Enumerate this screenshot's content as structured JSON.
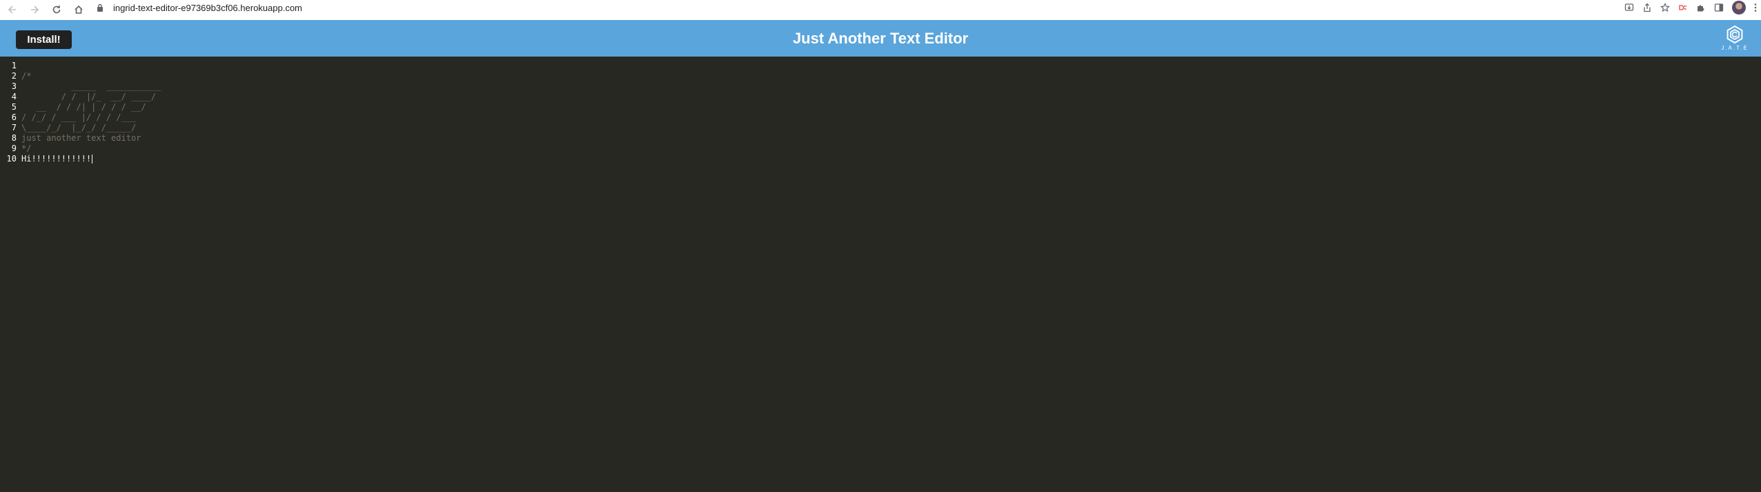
{
  "browser": {
    "url": "ingrid-text-editor-e97369b3cf06.herokuapp.com"
  },
  "header": {
    "install_label": "Install!",
    "title": "Just Another Text Editor",
    "logo_text": "J.A.T.E",
    "background": "#5aa5db"
  },
  "editor": {
    "theme_background": "#272822",
    "lines": [
      {
        "number": "1",
        "text": "",
        "style": "plain"
      },
      {
        "number": "2",
        "text": "/*",
        "style": "comment"
      },
      {
        "number": "3",
        "text": "          _____  ___________",
        "style": "comment"
      },
      {
        "number": "4",
        "text": "        / /  |/_  __/ ____/",
        "style": "comment"
      },
      {
        "number": "5",
        "text": "   __  / / /| | / / / __/",
        "style": "comment"
      },
      {
        "number": "6",
        "text": "/ /_/ / ___ |/ / / /___",
        "style": "comment"
      },
      {
        "number": "7",
        "text": "\\____/_/  |_/_/ /_____/",
        "style": "comment"
      },
      {
        "number": "8",
        "text": "just another text editor",
        "style": "comment"
      },
      {
        "number": "9",
        "text": "*/",
        "style": "comment"
      },
      {
        "number": "10",
        "text": "Hi!!!!!!!!!!!!",
        "style": "plain"
      }
    ]
  }
}
